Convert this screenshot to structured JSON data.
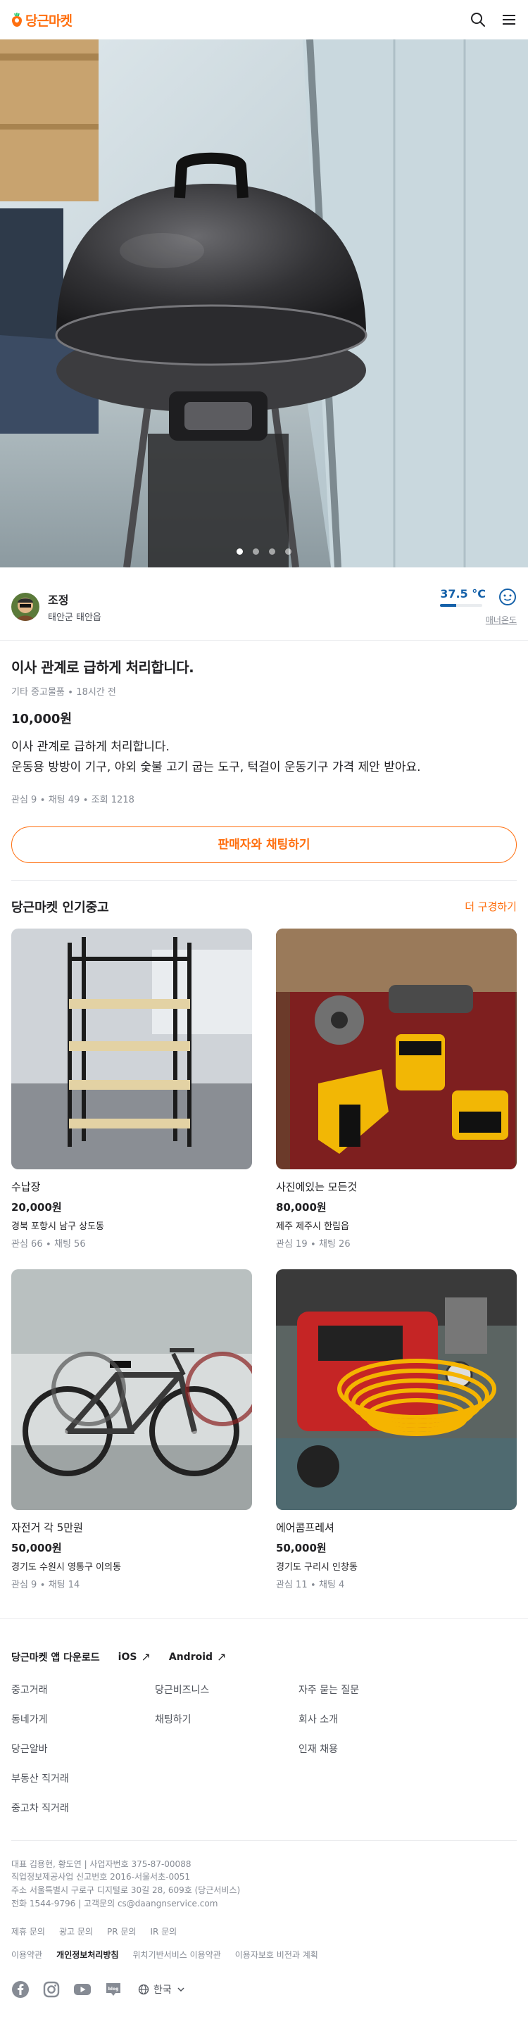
{
  "header": {
    "logo_text": "당근마켓",
    "brand_color": "#ff6f0f",
    "icons": [
      "search-icon",
      "menu-icon"
    ]
  },
  "carousel": {
    "current": 1,
    "total": 4
  },
  "seller": {
    "name": "조정",
    "region": "태안군 태안읍",
    "temperature": "37.5 °C",
    "temperature_value": 37.5,
    "manner_label": "매너온도",
    "temp_color": "#1561a9"
  },
  "article": {
    "title": "이사 관계로 급하게 처리합니다.",
    "meta": "기타 중고물품 ∙ 18시간 전",
    "price": "10,000원",
    "description_line1": "이사 관계로 급하게 처리합니다.",
    "description_line2": "운동용 방방이 기구, 야외 숯불 고기 굽는 도구, 턱걸이 운동기구 가격 제안 받아요.",
    "counts": "관심 9 ∙ 채팅 49 ∙ 조회 1218",
    "chat_button": "판매자와 채팅하기"
  },
  "popular": {
    "title": "당근마켓 인기중고",
    "more_link": "더 구경하기",
    "items": [
      {
        "title": "수납장",
        "price": "20,000원",
        "region": "경북 포항시 남구 상도동",
        "counts": "관심 66 ∙ 채팅 56"
      },
      {
        "title": "사진에있는 모든것",
        "price": "80,000원",
        "region": "제주 제주시 한림읍",
        "counts": "관심 19 ∙ 채팅 26"
      },
      {
        "title": "자전거 각 5만원",
        "price": "50,000원",
        "region": "경기도 수원시 영통구 이의동",
        "counts": "관심 9 ∙ 채팅 14"
      },
      {
        "title": "에어콤프레셔",
        "price": "50,000원",
        "region": "경기도 구리시 인창동",
        "counts": "관심 11 ∙ 채팅 4"
      }
    ]
  },
  "footer": {
    "app_download": "당근마켓 앱 다운로드",
    "ios": "iOS",
    "android": "Android",
    "links": [
      "중고거래",
      "당근비즈니스",
      "자주 묻는 질문",
      "동네가게",
      "채팅하기",
      "회사 소개",
      "당근알바",
      "",
      "인재 채용",
      "부동산 직거래",
      "",
      "",
      "중고차 직거래",
      "",
      ""
    ],
    "company_line1": "대표 김용현, 황도연 | 사업자번호 375-87-00088",
    "company_line2": "직업정보제공사업 신고번호 2016-서울서초-0051",
    "company_line3": "주소 서울특별시 구로구 디지털로 30길 28, 609호 (당근서비스)",
    "company_line4": "전화 1544-9796 | 고객문의 cs@daangnservice.com",
    "inquiries": [
      "제휴 문의",
      "광고 문의",
      "PR 문의",
      "IR 문의"
    ],
    "policies": [
      "이용약관",
      "개인정보처리방침",
      "위치기반서비스 이용약관",
      "이용자보호 비전과 계획"
    ],
    "social_icons": [
      "facebook-icon",
      "instagram-icon",
      "youtube-icon",
      "blog-icon"
    ],
    "language": "한국"
  }
}
